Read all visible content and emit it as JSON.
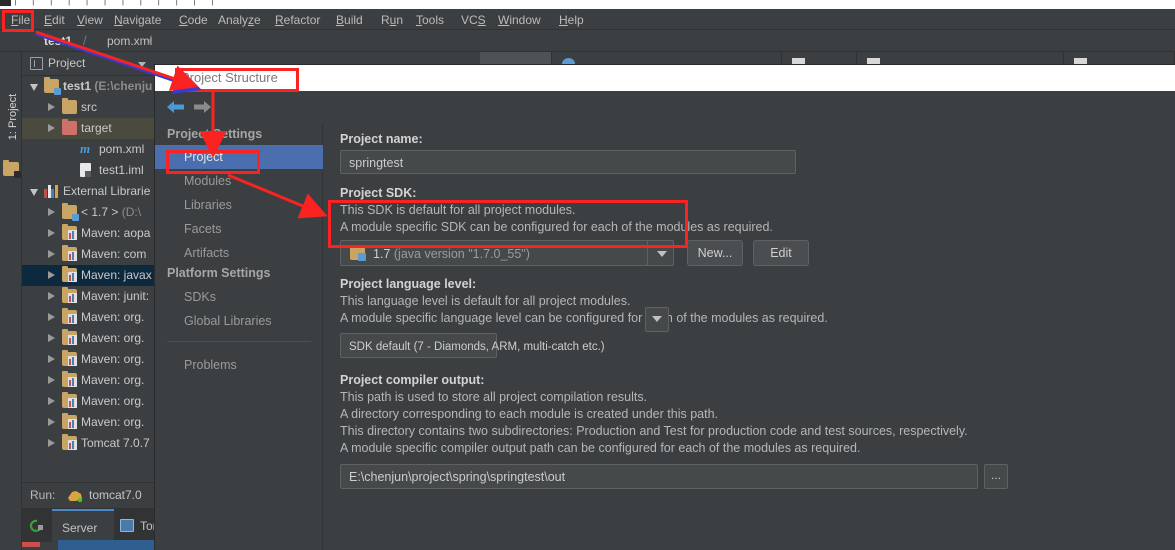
{
  "window": {
    "menu_items": [
      {
        "label": "File",
        "accel": "F"
      },
      {
        "label": "Edit",
        "accel": "E"
      },
      {
        "label": "View",
        "accel": "V"
      },
      {
        "label": "Navigate",
        "accel": "N"
      },
      {
        "label": "Code",
        "accel": "C"
      },
      {
        "label": "Analyze",
        "accel": "z"
      },
      {
        "label": "Refactor",
        "accel": "R"
      },
      {
        "label": "Build",
        "accel": "B"
      },
      {
        "label": "Run",
        "accel": "u"
      },
      {
        "label": "Tools",
        "accel": "T"
      },
      {
        "label": "VCS",
        "accel": "S"
      },
      {
        "label": "Window",
        "accel": "W"
      },
      {
        "label": "Help",
        "accel": "H"
      }
    ],
    "breadcrumb": {
      "project": "test1",
      "file": "pom.xml",
      "separator": "›"
    }
  },
  "tool_strip": {
    "label": "1: Project"
  },
  "project_panel": {
    "header": "Project",
    "tree": [
      {
        "label": "test1",
        "suffix": " (E:\\chenju",
        "icon": "folder-module",
        "depth": 0,
        "state": "open",
        "bold": true
      },
      {
        "label": "src",
        "suffix": "",
        "icon": "folder",
        "depth": 1,
        "state": "closed",
        "bold": false
      },
      {
        "label": "target",
        "suffix": "",
        "icon": "folder-red",
        "depth": 1,
        "state": "closed",
        "bold": false,
        "highlight": "dim"
      },
      {
        "label": "pom.xml",
        "suffix": "",
        "icon": "maven-m",
        "depth": 2,
        "state": "none",
        "bold": false
      },
      {
        "label": "test1.iml",
        "suffix": "",
        "icon": "file",
        "depth": 2,
        "state": "none",
        "bold": false
      },
      {
        "label": "External Librarie",
        "suffix": "",
        "icon": "library",
        "depth": 0,
        "state": "open",
        "bold": false
      },
      {
        "label": "< 1.7 >",
        "suffix": " (D:\\",
        "icon": "folder-sdk",
        "depth": 1,
        "state": "closed",
        "bold": false
      },
      {
        "label": "Maven: aopa",
        "suffix": "",
        "icon": "jar",
        "depth": 1,
        "state": "closed",
        "bold": false
      },
      {
        "label": "Maven: com",
        "suffix": "",
        "icon": "jar",
        "depth": 1,
        "state": "closed",
        "bold": false
      },
      {
        "label": "Maven: javax",
        "suffix": "",
        "icon": "jar",
        "depth": 1,
        "state": "closed",
        "bold": false,
        "highlight": "blue"
      },
      {
        "label": "Maven: junit:",
        "suffix": "",
        "icon": "jar",
        "depth": 1,
        "state": "closed",
        "bold": false
      },
      {
        "label": "Maven: org.",
        "suffix": "",
        "icon": "jar",
        "depth": 1,
        "state": "closed",
        "bold": false
      },
      {
        "label": "Maven: org.",
        "suffix": "",
        "icon": "jar",
        "depth": 1,
        "state": "closed",
        "bold": false
      },
      {
        "label": "Maven: org.",
        "suffix": "",
        "icon": "jar",
        "depth": 1,
        "state": "closed",
        "bold": false
      },
      {
        "label": "Maven: org.",
        "suffix": "",
        "icon": "jar",
        "depth": 1,
        "state": "closed",
        "bold": false
      },
      {
        "label": "Maven: org.",
        "suffix": "",
        "icon": "jar",
        "depth": 1,
        "state": "closed",
        "bold": false
      },
      {
        "label": "Maven: org.",
        "suffix": "",
        "icon": "jar",
        "depth": 1,
        "state": "closed",
        "bold": false
      },
      {
        "label": "Tomcat 7.0.7",
        "suffix": "",
        "icon": "jar",
        "depth": 1,
        "state": "closed",
        "bold": false
      }
    ]
  },
  "run_panel": {
    "run_label": "Run:",
    "config_name": "tomcat7.0",
    "tabs": [
      {
        "label": "Server",
        "active": true
      },
      {
        "label": "Tomc",
        "active": false
      }
    ]
  },
  "dialog": {
    "title": "Project Structure",
    "sidebar": {
      "section_project": "Project Settings",
      "section_platform": "Platform Settings",
      "items": [
        {
          "label": "Project",
          "active": true
        },
        {
          "label": "Modules",
          "active": false
        },
        {
          "label": "Libraries",
          "active": false
        },
        {
          "label": "Facets",
          "active": false
        },
        {
          "label": "Artifacts",
          "active": false
        }
      ],
      "platform_items": [
        {
          "label": "SDKs",
          "active": false
        },
        {
          "label": "Global Libraries",
          "active": false
        }
      ],
      "problems": "Problems"
    },
    "main": {
      "project_name_label": "Project name:",
      "project_name_value": "springtest",
      "sdk_label": "Project SDK:",
      "sdk_desc_line1": "This SDK is default for all project modules.",
      "sdk_desc_line2": "A module specific SDK can be configured for each of the modules as required.",
      "sdk_value_name": "1.7",
      "sdk_value_detail": "(java version \"1.7.0_55\")",
      "new_button": "New...",
      "edit_button": "Edit",
      "lang_label": "Project language level:",
      "lang_desc_line1": "This language level is default for all project modules.",
      "lang_desc_line2": "A module specific language level can be configured for each of the modules as required.",
      "lang_value": "SDK default (7 - Diamonds, ARM, multi-catch etc.)",
      "out_label": "Project compiler output:",
      "out_desc_line1": "This path is used to store all project compilation results.",
      "out_desc_line2": "A directory corresponding to each module is created under this path.",
      "out_desc_line3": "This directory contains two subdirectories: Production and Test for production code and test sources, respectively.",
      "out_desc_line4": "A module specific compiler output path can be configured for each of the modules as required.",
      "out_value": "E:\\chenjun\\project\\spring\\springtest\\out",
      "browse_button": "..."
    }
  },
  "annotations": {
    "highlight_color": "#fb2222",
    "arrow_color": "#fb2222"
  }
}
